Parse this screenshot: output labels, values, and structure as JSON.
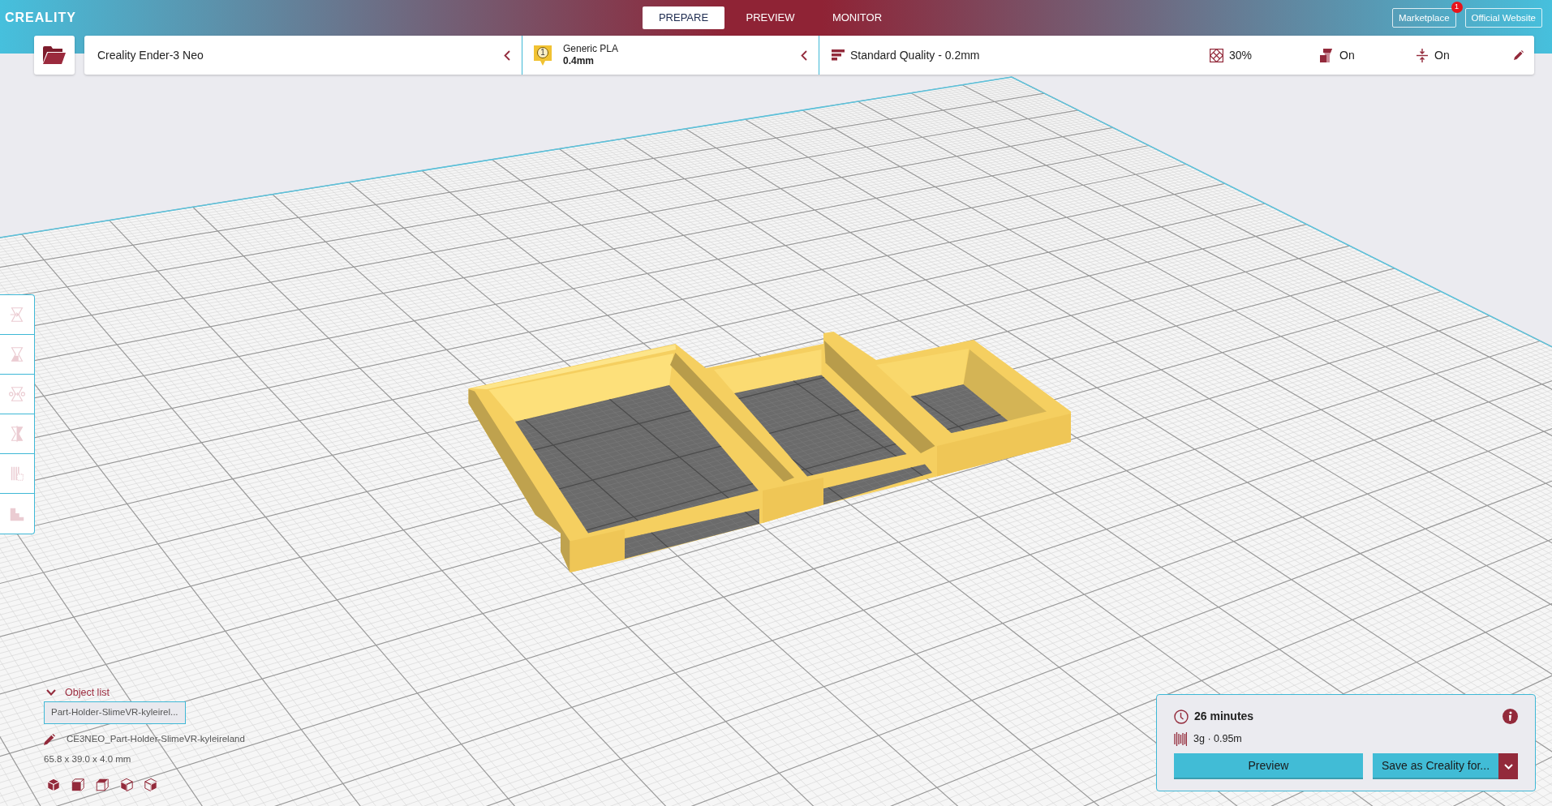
{
  "header": {
    "logo": "CREALITY",
    "tabs": [
      {
        "label": "PREPARE",
        "selected": true
      },
      {
        "label": "PREVIEW",
        "selected": false
      },
      {
        "label": "MONITOR",
        "selected": false
      }
    ],
    "links": [
      {
        "label": "Marketplace",
        "badge": "1"
      },
      {
        "label": "Official Website"
      }
    ]
  },
  "toolbar": {
    "printer": "Creality Ender-3 Neo",
    "material": {
      "extruder": "1",
      "name": "Generic PLA",
      "nozzle": "0.4mm"
    },
    "print_settings": {
      "profile": "Standard Quality - 0.2mm",
      "infill": "30%",
      "support": "On",
      "adhesion": "On"
    }
  },
  "tools": [
    {
      "kind": "move",
      "disabled": true
    },
    {
      "kind": "scale",
      "disabled": true
    },
    {
      "kind": "rotate",
      "disabled": true
    },
    {
      "kind": "mirror",
      "disabled": true
    },
    {
      "kind": "per_model_settings",
      "disabled": true
    },
    {
      "kind": "support_blocker",
      "disabled": true
    }
  ],
  "object_list": {
    "title": "Object list",
    "expanded": true,
    "items": [
      {
        "name": "Part-Holder-SlimeVR-kyleirel..."
      }
    ],
    "job_name": "CE3NEO_Part-Holder-SlimeVR-kyleireland",
    "dimensions": "65.8 x 39.0 x 4.0 mm",
    "views": [
      {
        "kind": "isometric"
      },
      {
        "kind": "front"
      },
      {
        "kind": "top"
      },
      {
        "kind": "left"
      },
      {
        "kind": "right"
      }
    ]
  },
  "print_summary": {
    "time": "26 minutes",
    "material_usage": "3g · 0.95m",
    "preview_button": "Preview",
    "save_button": "Save as Creality for..."
  }
}
